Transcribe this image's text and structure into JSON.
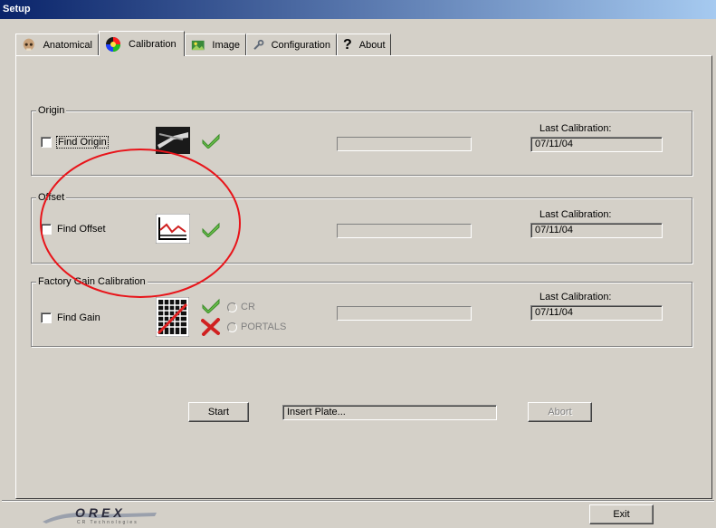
{
  "window": {
    "title": "Setup"
  },
  "tabs": [
    {
      "label": "Anatomical",
      "icon": "skull-icon"
    },
    {
      "label": "Calibration",
      "icon": "color-wheel-icon",
      "active": true
    },
    {
      "label": "Image",
      "icon": "image-icon"
    },
    {
      "label": "Configuration",
      "icon": "wrench-icon"
    },
    {
      "label": "About",
      "icon": "question-icon"
    }
  ],
  "groups": {
    "origin": {
      "title": "Origin",
      "checkbox": "Find Origin",
      "last_label": "Last Calibration:",
      "last_value": "07/11/04"
    },
    "offset": {
      "title": "Offset",
      "checkbox": "Find Offset",
      "last_label": "Last Calibration:",
      "last_value": "07/11/04"
    },
    "gain": {
      "title": "Factory Gain Calibration",
      "checkbox": "Find Gain",
      "radio_cr": "CR",
      "radio_portals": "PORTALS",
      "last_label": "Last Calibration:",
      "last_value": "07/11/04"
    }
  },
  "actions": {
    "start": "Start",
    "status": "Insert Plate...",
    "abort": "Abort",
    "exit": "Exit"
  },
  "brand": {
    "logo_text": "OREX",
    "logo_sub": "CR Technologies"
  },
  "colors": {
    "title_start": "#0a246a",
    "title_end": "#a6caf0",
    "check_green": "#6cc04a",
    "annotation_red": "#e8141a"
  }
}
